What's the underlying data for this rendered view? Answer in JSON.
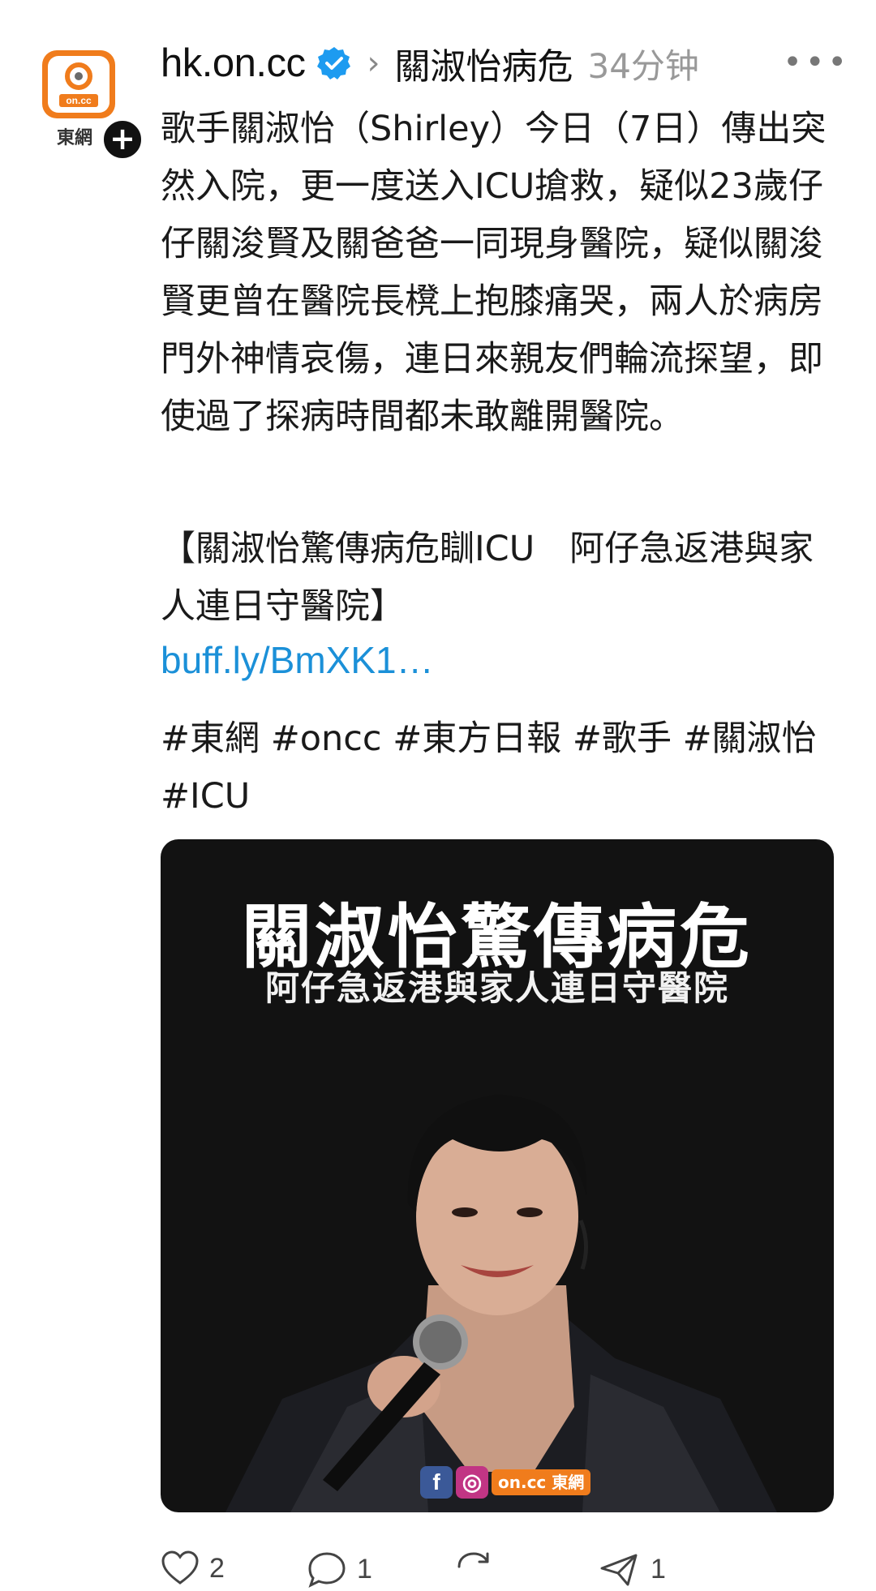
{
  "account": {
    "brand_text": "東網",
    "logo_text": "on.cc",
    "follow_symbol": "+",
    "username": "hk.on.cc",
    "verified_icon": "verified-check-icon",
    "chevron": "›",
    "topic": "關淑怡病危",
    "time": "34分钟",
    "more": "•••"
  },
  "post": {
    "body": "歌手關淑怡（Shirley）今日（7日）傳出突然入院，更一度送入ICU搶救，疑似23歲仔仔關浚賢及關爸爸一同現身醫院，疑似關浚賢更曾在醫院長櫈上抱膝痛哭，兩人於病房門外神情哀傷，連日來親友們輪流探望，即使過了探病時間都未敢離開醫院。",
    "headline": "【關淑怡驚傳病危瞓ICU　阿仔急返港與家人連日守醫院】",
    "link": "buff.ly/BmXK1…",
    "tags": "#東網 #oncc #東方日報 #歌手 #關淑怡 #ICU"
  },
  "image": {
    "title": "關淑怡驚傳病危",
    "subtitle": "阿仔急返港與家人連日守醫院",
    "social_fb": "f",
    "social_ig": "◎",
    "watermark": "on.cc 東網"
  },
  "actions": {
    "like_count": "2",
    "comment_count": "1",
    "repost_count": "",
    "share_count": "1"
  },
  "colors": {
    "accent_link": "#1b90d8",
    "brand_orange": "#f07c1c",
    "verified_blue": "#1d9bf0"
  }
}
